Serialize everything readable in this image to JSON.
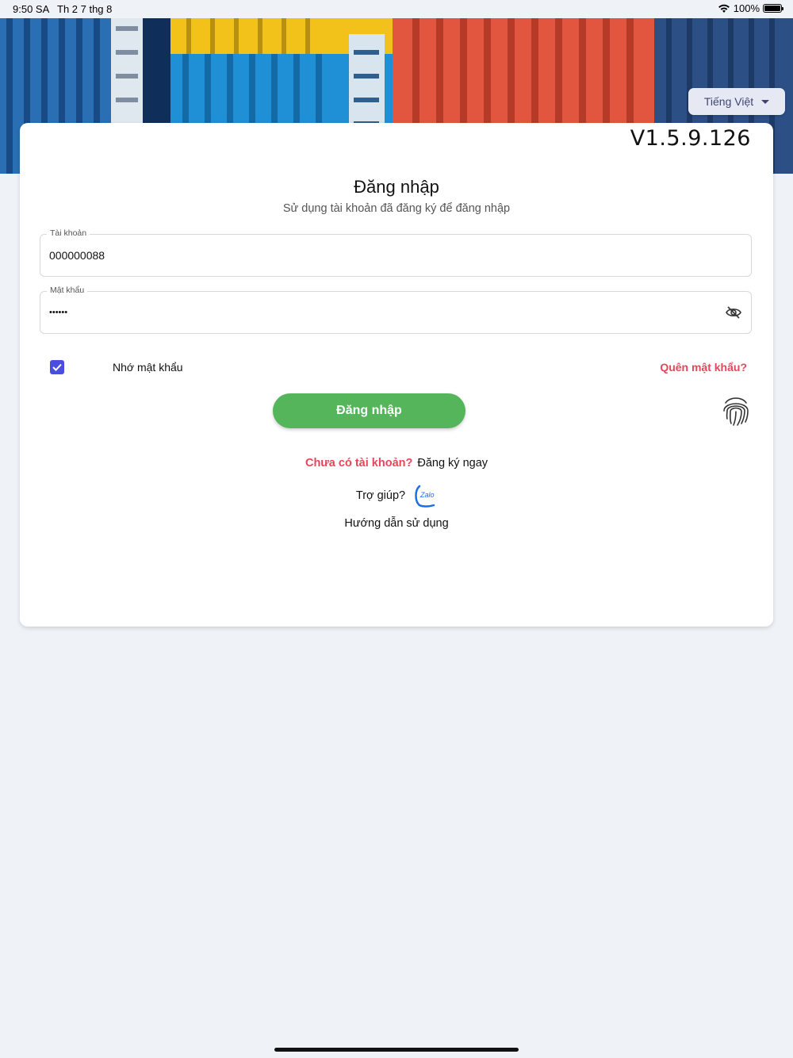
{
  "status_bar": {
    "time": "9:50 SA",
    "date": "Th 2 7 thg 8",
    "battery": "100%"
  },
  "language_selector": {
    "label": "Tiếng Việt"
  },
  "version": "V1.5.9.126",
  "login_form": {
    "title": "Đăng nhập",
    "subtitle": "Sử dụng tài khoản đã đăng ký để đăng nhập",
    "username_label": "Tài khoản",
    "username_value": "000000088",
    "password_label": "Mật khẩu",
    "password_value": "••••••",
    "remember_label": "Nhớ mật khẩu",
    "remember_checked": true,
    "forgot_label": "Quên mật khẩu?",
    "submit_label": "Đăng nhập"
  },
  "signup": {
    "question": "Chưa có tài khoản?",
    "action": "Đăng ký ngay"
  },
  "help": {
    "label": "Trợ giúp?",
    "zalo_text": "Zalo",
    "guide_label": "Hướng dẫn sử dụng"
  },
  "colors": {
    "accent_red": "#e8445a",
    "login_green": "#55b55a",
    "checkbox_blue": "#4a4ee0",
    "background": "#eff3f8"
  }
}
